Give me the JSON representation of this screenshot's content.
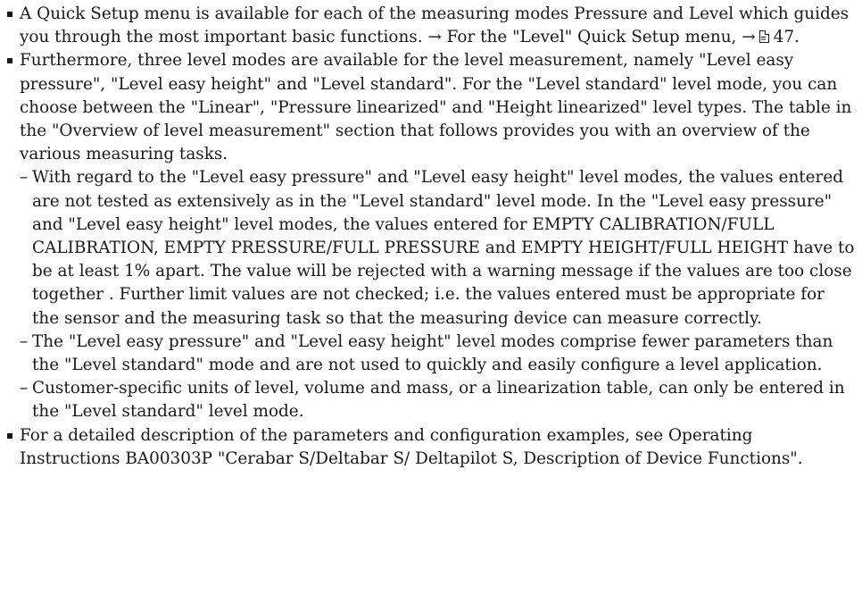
{
  "document": {
    "items": [
      {
        "text_before_ref": "A Quick Setup menu is available for each of the measuring modes Pressure and Level which guides you through the most important basic functions. → For the \"Level\" Quick Setup menu, →",
        "page_ref": "47."
      },
      {
        "text": "Furthermore, three level modes are available for the level measurement, namely \"Level easy pressure\", \"Level easy height\" and \"Level standard\". For the \"Level standard\" level mode, you can choose between the \"Linear\", \"Pressure linearized\" and \"Height linearized\" level types. The table in the \"Overview of level measurement\" section that follows provides you with an overview of the various measuring tasks.",
        "subitems": [
          "With regard to the \"Level easy pressure\" and \"Level easy height\" level modes, the values entered are not tested as extensively as in the \"Level standard\" level mode. In the \"Level easy pressure\" and \"Level easy height\" level modes, the values entered for EMPTY CALIBRATION/FULL CALIBRATION, EMPTY PRESSURE/FULL PRESSURE and EMPTY HEIGHT/FULL HEIGHT have to be at least 1% apart. The value will be rejected with a warning message if the values are too close together . Further limit values are not checked; i.e. the values entered must be appropriate for the sensor and the measuring task so that the measuring device can measure correctly.",
          "The \"Level easy pressure\" and \"Level easy height\" level modes comprise fewer parameters than the \"Level standard\" mode and are not used to quickly and easily configure a level application.",
          "Customer-specific units of level, volume and mass, or a linearization table, can only be entered in the \"Level standard\" level mode."
        ]
      },
      {
        "text": "For a detailed description of the parameters and configuration examples, see Operating Instructions BA00303P \"Cerabar S/Deltabar S/ Deltapilot S, Description of Device Functions\"."
      }
    ],
    "dash": "–"
  }
}
